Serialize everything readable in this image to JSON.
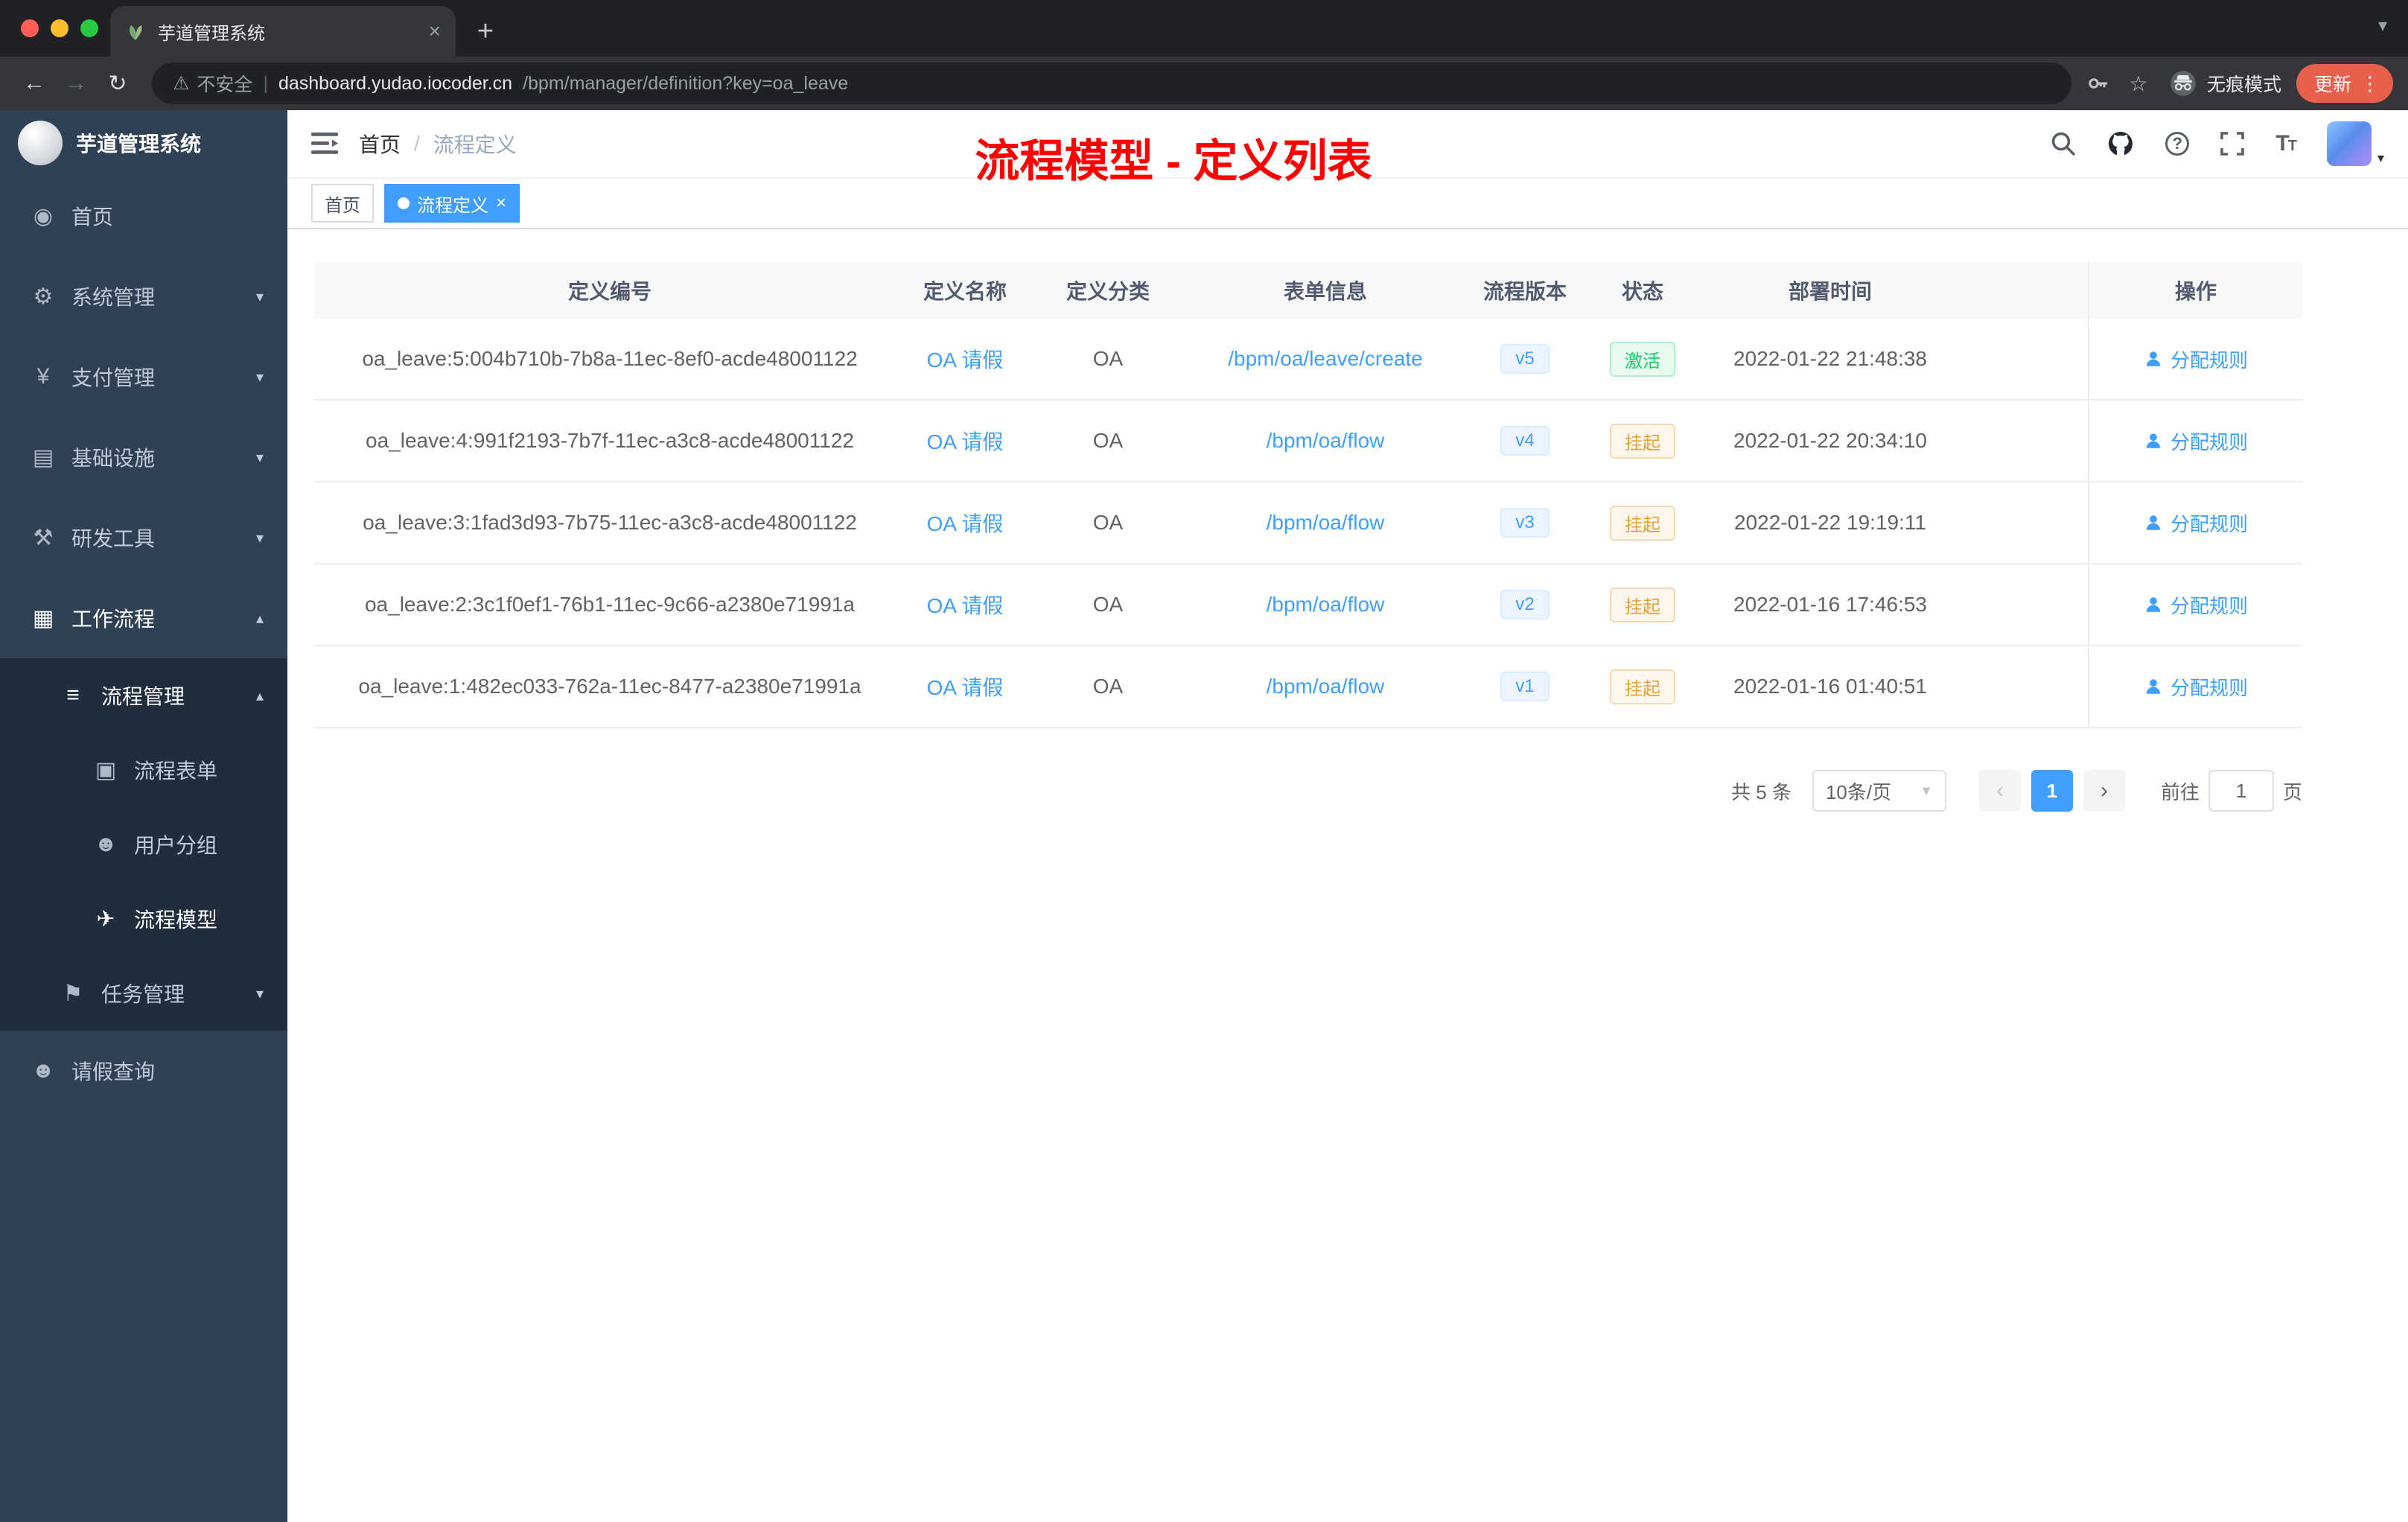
{
  "colors": {
    "accent_blue": "#409eff",
    "status_active_green": "#13ce66",
    "status_suspend_orange": "#e6a23c",
    "annotation_red": "#ff0000",
    "update_pill_orange": "#e8604c",
    "sidebar_bg": "#304156",
    "submenu_bg": "#1f2d3d"
  },
  "browser": {
    "tab_title": "芋道管理系统",
    "new_tab_button": "+",
    "security_label": "不安全",
    "url_host": "dashboard.yudao.iocoder.cn",
    "url_path": "/bpm/manager/definition?key=oa_leave",
    "incognito_label": "无痕模式",
    "update_label": "更新",
    "kebab": "⋮",
    "back": "←",
    "forward": "→",
    "reload": "↻",
    "star": "☆",
    "warning": "⚠",
    "divider": "|"
  },
  "sidebar": {
    "logo_title": "芋道管理系统",
    "items": [
      {
        "label": "首页",
        "icon": "dashboard-icon",
        "glyph": "◉",
        "state": "top",
        "chevron": "none"
      },
      {
        "label": "系统管理",
        "icon": "gear-icon",
        "glyph": "⚙",
        "state": "top",
        "chevron": "down"
      },
      {
        "label": "支付管理",
        "icon": "yen-icon",
        "glyph": "¥",
        "state": "top",
        "chevron": "down"
      },
      {
        "label": "基础设施",
        "icon": "infrastructure-icon",
        "glyph": "▤",
        "state": "top",
        "chevron": "down"
      },
      {
        "label": "研发工具",
        "icon": "tools-icon",
        "glyph": "⚒",
        "state": "top",
        "chevron": "down"
      },
      {
        "label": "工作流程",
        "icon": "workflow-icon",
        "glyph": "▦",
        "state": "top active",
        "chevron": "up"
      },
      {
        "label": "流程管理",
        "icon": "process-list-icon",
        "glyph": "≡",
        "state": "sub active",
        "chevron": "up"
      },
      {
        "label": "流程表单",
        "icon": "form-icon",
        "glyph": "▣",
        "state": "subsub",
        "chevron": "none"
      },
      {
        "label": "用户分组",
        "icon": "user-group-icon",
        "glyph": "☻",
        "state": "subsub",
        "chevron": "none"
      },
      {
        "label": "流程模型",
        "icon": "paper-plane-icon",
        "glyph": "✈",
        "state": "subsub active",
        "chevron": "none"
      },
      {
        "label": "任务管理",
        "icon": "task-flag-icon",
        "glyph": "⚑",
        "state": "sub",
        "chevron": "down"
      },
      {
        "label": "请假查询",
        "icon": "user-icon",
        "glyph": "☻",
        "state": "top",
        "chevron": "none"
      }
    ]
  },
  "navbar": {
    "breadcrumb": {
      "home": "首页",
      "separator": "/",
      "current": "流程定义"
    }
  },
  "annotation": "流程模型 - 定义列表",
  "tags": [
    {
      "label": "首页",
      "state": "plain"
    },
    {
      "label": "流程定义",
      "state": "active",
      "closable": "×"
    }
  ],
  "table": {
    "columns": [
      "定义编号",
      "定义名称",
      "定义分类",
      "表单信息",
      "流程版本",
      "状态",
      "部署时间",
      "操作"
    ],
    "rows": [
      {
        "id": "oa_leave:5:004b710b-7b8a-11ec-8ef0-acde48001122",
        "name": "OA 请假",
        "category": "OA",
        "form": "/bpm/oa/leave/create",
        "version": "v5",
        "status": "激活",
        "status_type": "success",
        "deploy_time": "2022-01-22 21:48:38",
        "action": "分配规则"
      },
      {
        "id": "oa_leave:4:991f2193-7b7f-11ec-a3c8-acde48001122",
        "name": "OA 请假",
        "category": "OA",
        "form": "/bpm/oa/flow",
        "version": "v4",
        "status": "挂起",
        "status_type": "warning",
        "deploy_time": "2022-01-22 20:34:10",
        "action": "分配规则"
      },
      {
        "id": "oa_leave:3:1fad3d93-7b75-11ec-a3c8-acde48001122",
        "name": "OA 请假",
        "category": "OA",
        "form": "/bpm/oa/flow",
        "version": "v3",
        "status": "挂起",
        "status_type": "warning",
        "deploy_time": "2022-01-22 19:19:11",
        "action": "分配规则"
      },
      {
        "id": "oa_leave:2:3c1f0ef1-76b1-11ec-9c66-a2380e71991a",
        "name": "OA 请假",
        "category": "OA",
        "form": "/bpm/oa/flow",
        "version": "v2",
        "status": "挂起",
        "status_type": "warning",
        "deploy_time": "2022-01-16 17:46:53",
        "action": "分配规则"
      },
      {
        "id": "oa_leave:1:482ec033-762a-11ec-8477-a2380e71991a",
        "name": "OA 请假",
        "category": "OA",
        "form": "/bpm/oa/flow",
        "version": "v1",
        "status": "挂起",
        "status_type": "warning",
        "deploy_time": "2022-01-16 01:40:51",
        "action": "分配规则"
      }
    ]
  },
  "pagination": {
    "total": "共 5 条",
    "page_size": "10条/页",
    "prev": "‹",
    "page": "1",
    "next": "›",
    "goto_label": "前往",
    "goto_value": "1",
    "unit_label": "页"
  }
}
